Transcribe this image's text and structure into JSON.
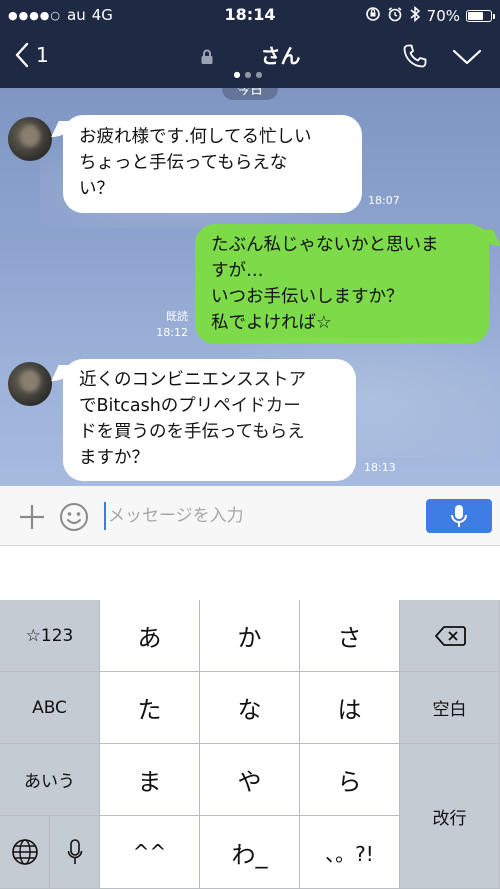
{
  "status_bar": {
    "signal": "●●●●○",
    "carrier": "au",
    "network": "4G",
    "time": "18:14",
    "battery_text": "70%",
    "battery_level": 0.7
  },
  "header": {
    "back_count": "1",
    "title": "さん"
  },
  "chat": {
    "date_label": "今日",
    "messages": [
      {
        "from": "incoming",
        "lines": [
          "お疲れ様です.何してる忙しい",
          "ちょっと手伝ってもらえな",
          "い？"
        ],
        "time": "18:07"
      },
      {
        "from": "outgoing",
        "lines": [
          "たぶん私じゃないかと思いま",
          "すが…",
          "いつお手伝いしますか？",
          "私でよければ☆"
        ],
        "read_label": "既読",
        "time": "18:12"
      },
      {
        "from": "incoming",
        "lines": [
          "近くのコンビニエンスストア",
          "でBitcashのプリペイドカー",
          "ドを買うのを手伝ってもらえ",
          "ますか？"
        ],
        "time": "18:13"
      }
    ]
  },
  "input": {
    "placeholder": "メッセージを入力"
  },
  "keyboard": {
    "row1": [
      "☆123",
      "あ",
      "か",
      "さ"
    ],
    "row2": [
      "ABC",
      "た",
      "な",
      "は",
      "空白"
    ],
    "row3": [
      "あいう",
      "ま",
      "や",
      "ら",
      "改行"
    ],
    "row4": [
      "^^",
      "わ_",
      "、。?!"
    ]
  },
  "colors": {
    "header_bg": "#1e2a44",
    "outgoing_bubble": "#7ddb4a",
    "incoming_bubble": "#ffffff",
    "mic_button": "#3e7ee4"
  }
}
